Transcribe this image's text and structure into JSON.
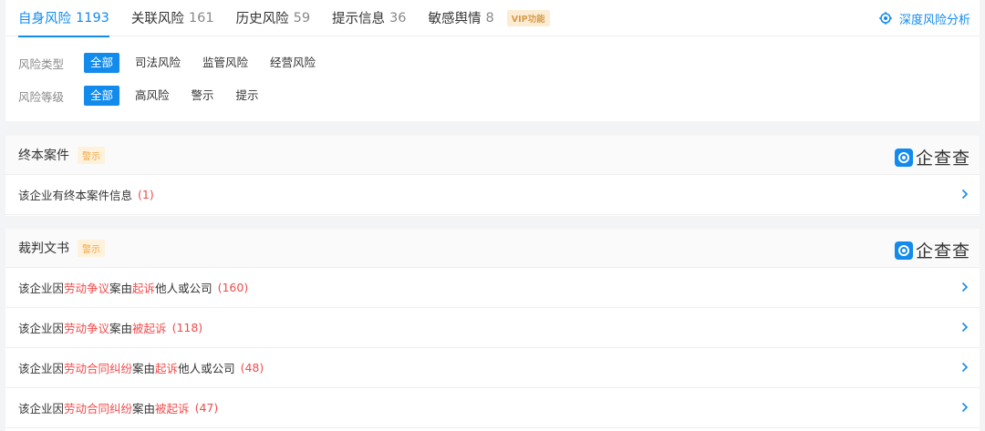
{
  "tabs": [
    {
      "label": "自身风险",
      "count": "1193"
    },
    {
      "label": "关联风险",
      "count": "161"
    },
    {
      "label": "历史风险",
      "count": "59"
    },
    {
      "label": "提示信息",
      "count": "36"
    },
    {
      "label": "敏感舆情",
      "count": "8"
    }
  ],
  "vip_badge": "VIP功能",
  "deep_analysis": "深度风险分析",
  "filters": {
    "type_label": "风险类型",
    "type_options": [
      "全部",
      "司法风险",
      "监管风险",
      "经营风险"
    ],
    "level_label": "风险等级",
    "level_options": [
      "全部",
      "高风险",
      "警示",
      "提示"
    ]
  },
  "logo_text": "企查查",
  "sections": {
    "final_case": {
      "title": "终本案件",
      "badge": "警示",
      "rows": [
        {
          "prefix": "该企业有终本案件信息",
          "count": "(1)"
        }
      ]
    },
    "judgment": {
      "title": "裁判文书",
      "badge": "警示",
      "rows": [
        {
          "p1": "该企业因",
          "h1": "劳动争议",
          "p2": "案由",
          "h2": "起诉",
          "p3": "他人或公司",
          "count": "(160)"
        },
        {
          "p1": "该企业因",
          "h1": "劳动争议",
          "p2": "案由",
          "h2": "被起诉",
          "p3": "",
          "count": "(118)"
        },
        {
          "p1": "该企业因",
          "h1": "劳动合同纠纷",
          "p2": "案由",
          "h2": "起诉",
          "p3": "他人或公司",
          "count": "(48)"
        },
        {
          "p1": "该企业因",
          "h1": "劳动合同纠纷",
          "p2": "案由",
          "h2": "被起诉",
          "p3": "",
          "count": "(47)"
        }
      ]
    }
  },
  "colors": {
    "accent": "#128bed",
    "highlight": "#f04c4c",
    "warn": "#f2a33a"
  }
}
